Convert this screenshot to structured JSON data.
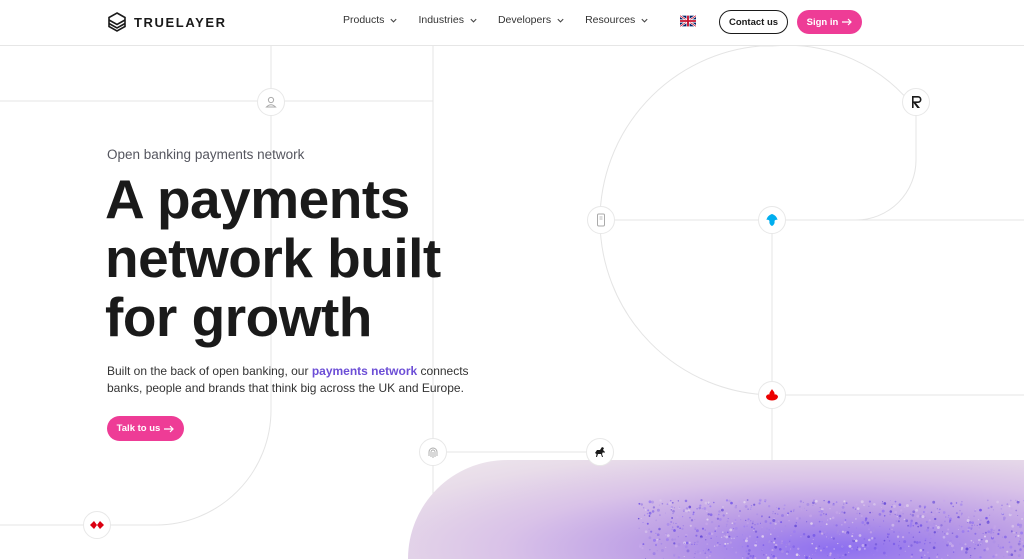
{
  "brand": {
    "name": "TRUELAYER"
  },
  "nav": {
    "items": [
      {
        "label": "Products"
      },
      {
        "label": "Industries"
      },
      {
        "label": "Developers"
      },
      {
        "label": "Resources"
      }
    ]
  },
  "header": {
    "contact_label": "Contact us",
    "signin_label": "Sign in"
  },
  "hero": {
    "eyebrow": "Open banking payments network",
    "headline_line1": "A payments",
    "headline_line2": "network built",
    "headline_line3": "for growth",
    "sub_before": "Built on the back of open banking, our ",
    "sub_link": "payments network",
    "sub_after": " connects banks, people and brands that think big across the UK and Europe.",
    "cta_label": "Talk to us"
  },
  "icons": {
    "user": "user-icon",
    "revolut": "revolut-logo-icon",
    "phone": "phone-icon",
    "barclays": "barclays-eagle-icon",
    "santander": "santander-flame-icon",
    "fingerprint": "fingerprint-icon",
    "lloyds": "lloyds-horse-icon",
    "hsbc": "hsbc-hexagon-icon",
    "flag": "uk-flag-icon"
  },
  "colors": {
    "accent": "#ee3c96",
    "link": "#6c4ed6",
    "text": "#1a1a1a",
    "lines": "#e4e4e4"
  }
}
